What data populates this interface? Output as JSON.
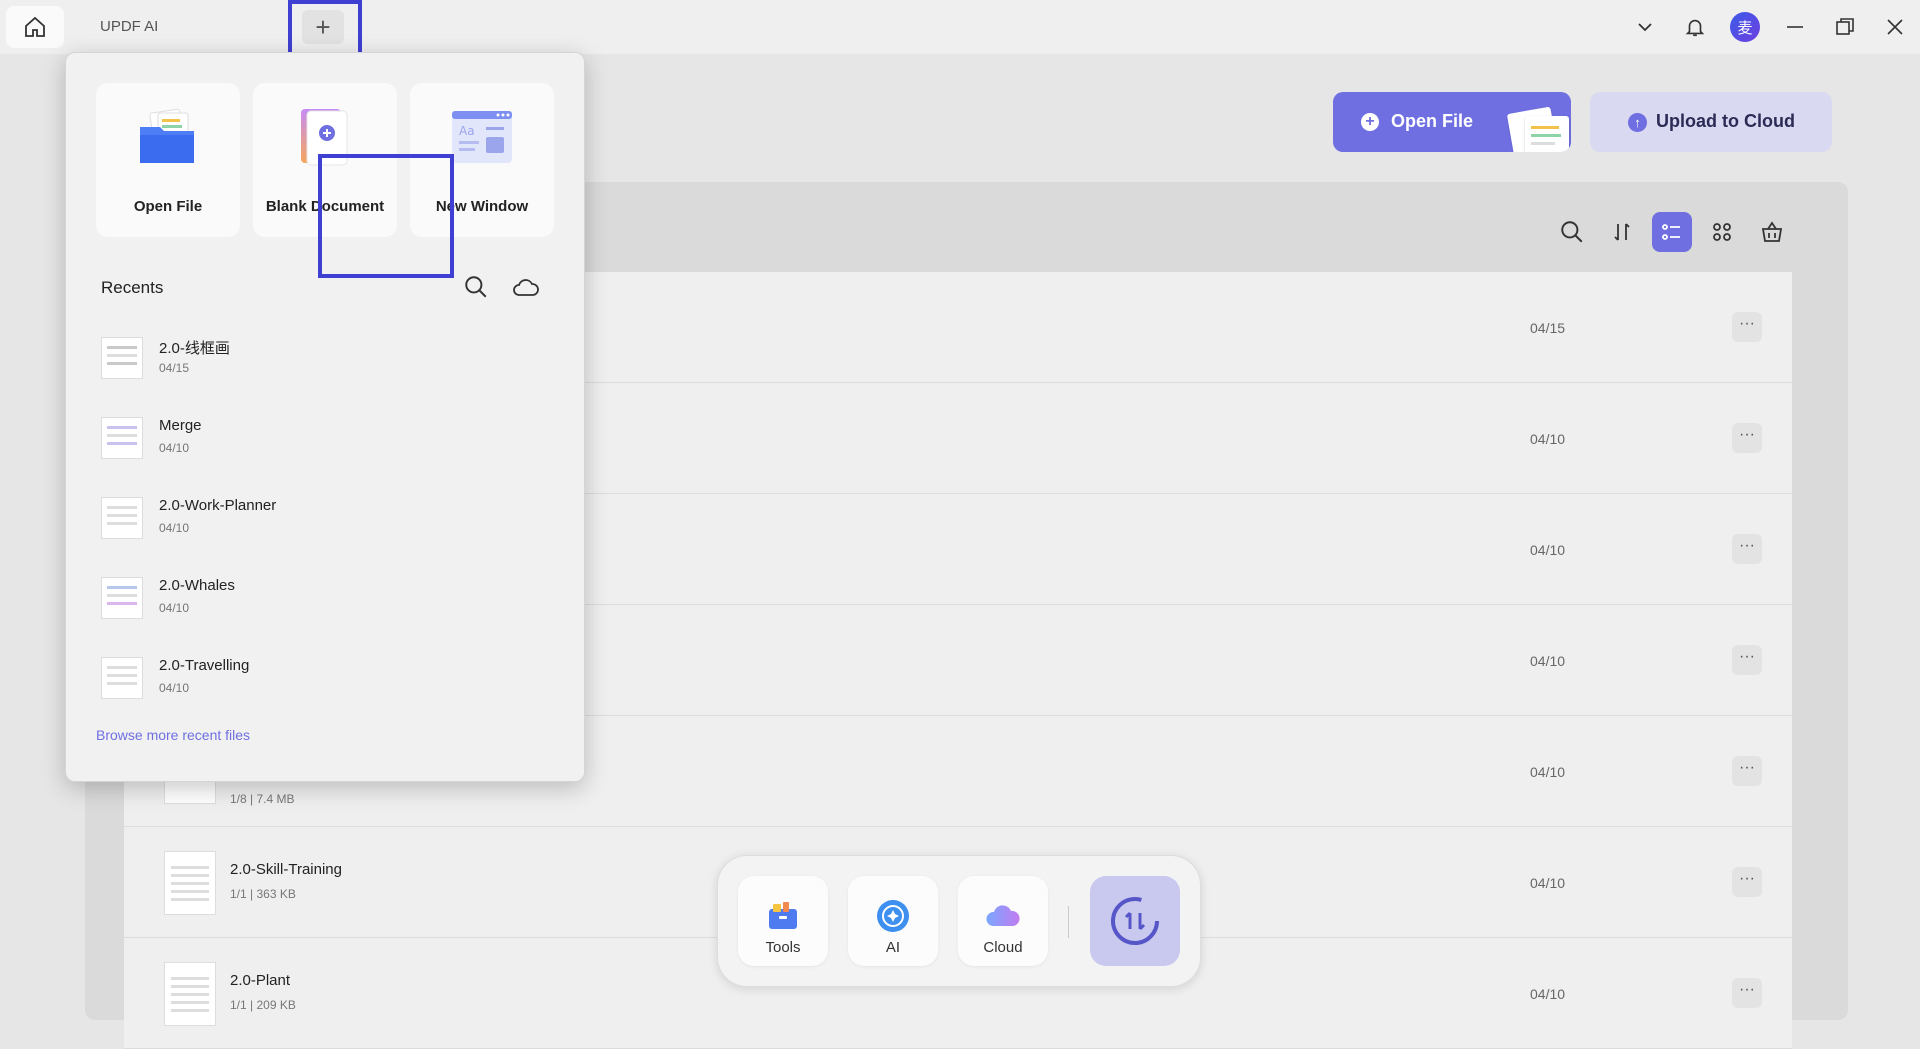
{
  "titlebar": {
    "tab_label": "UPDF AI",
    "add_tab_symbol": "+",
    "avatar_initial": "麦"
  },
  "header": {
    "open_file_label": "Open File",
    "upload_label": "Upload to Cloud"
  },
  "popup": {
    "cards": [
      {
        "label": "Open File",
        "icon": "folder-icon"
      },
      {
        "label": "Blank Document",
        "icon": "blank-document-icon"
      },
      {
        "label": "New Window",
        "icon": "new-window-icon"
      }
    ],
    "recents_title": "Recents",
    "recents": [
      {
        "name": "2.0-线框画",
        "date": "04/15"
      },
      {
        "name": "Merge",
        "date": "04/10"
      },
      {
        "name": "2.0-Work-Planner",
        "date": "04/10"
      },
      {
        "name": "2.0-Whales",
        "date": "04/10"
      },
      {
        "name": "2.0-Travelling",
        "date": "04/10"
      }
    ],
    "browse_more": "Browse more recent files"
  },
  "file_list": {
    "rows": [
      {
        "name": "",
        "meta": "",
        "date": "04/15"
      },
      {
        "name": "",
        "meta": "",
        "date": "04/10"
      },
      {
        "name": "",
        "meta": "",
        "date": "04/10"
      },
      {
        "name": "",
        "meta": "",
        "date": "04/10"
      },
      {
        "name": "",
        "meta": "1/8 | 7.4 MB",
        "date": "04/10"
      },
      {
        "name": "2.0-Skill-Training",
        "meta": "1/1 | 363 KB",
        "date": "04/10"
      },
      {
        "name": "2.0-Plant",
        "meta": "1/1 | 209 KB",
        "date": "04/10"
      }
    ],
    "more_symbol": "···"
  },
  "dock": {
    "tools_label": "Tools",
    "ai_label": "AI",
    "cloud_label": "Cloud"
  },
  "colors": {
    "accent": "#6f6fe2",
    "highlight": "#3f3fd2"
  }
}
